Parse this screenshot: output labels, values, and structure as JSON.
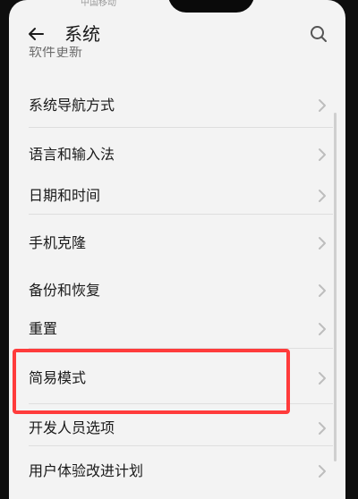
{
  "status": {
    "fragment": "中国移动"
  },
  "header": {
    "title": "系统"
  },
  "list": {
    "partial_item": "软件更新",
    "items": [
      {
        "label": "系统导航方式"
      },
      {
        "label": "语言和输入法"
      },
      {
        "label": "日期和时间"
      },
      {
        "label": "手机克隆"
      },
      {
        "label": "备份和恢复"
      },
      {
        "label": "重置"
      },
      {
        "label": "简易模式"
      },
      {
        "label": "开发人员选项"
      },
      {
        "label": "用户体验改进计划"
      }
    ]
  },
  "icons": {
    "back": "arrow-left",
    "search": "magnifier",
    "chevron": "chevron-right"
  },
  "colors": {
    "background": "#f3f3f3",
    "highlight": "#ff3b3b",
    "text": "#1a1a1a",
    "chevron": "#bdbdbd",
    "bezel": "#0e0e0e"
  }
}
